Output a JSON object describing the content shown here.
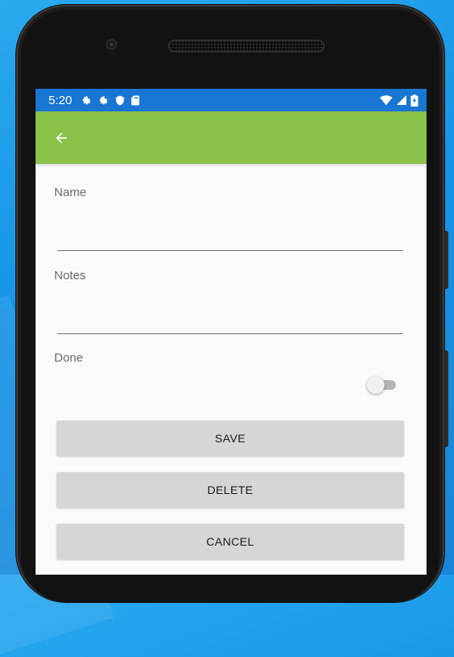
{
  "status_bar": {
    "time": "5:20",
    "icons": [
      "gear-icon",
      "gear-icon",
      "shield-icon",
      "sd-card-icon"
    ],
    "right_icons": [
      "wifi-icon",
      "signal-icon",
      "battery-icon"
    ]
  },
  "app_bar": {
    "back_icon": "arrow-left-icon",
    "color": "#8bc34a"
  },
  "form": {
    "name_label": "Name",
    "name_value": "",
    "notes_label": "Notes",
    "notes_value": "",
    "done_label": "Done",
    "done_checked": false
  },
  "buttons": {
    "save": "SAVE",
    "delete": "DELETE",
    "cancel": "CANCEL"
  },
  "colors": {
    "status_bar": "#1976d2",
    "app_bar": "#8bc34a",
    "button": "#d6d6d6",
    "background": "#1593e6"
  }
}
